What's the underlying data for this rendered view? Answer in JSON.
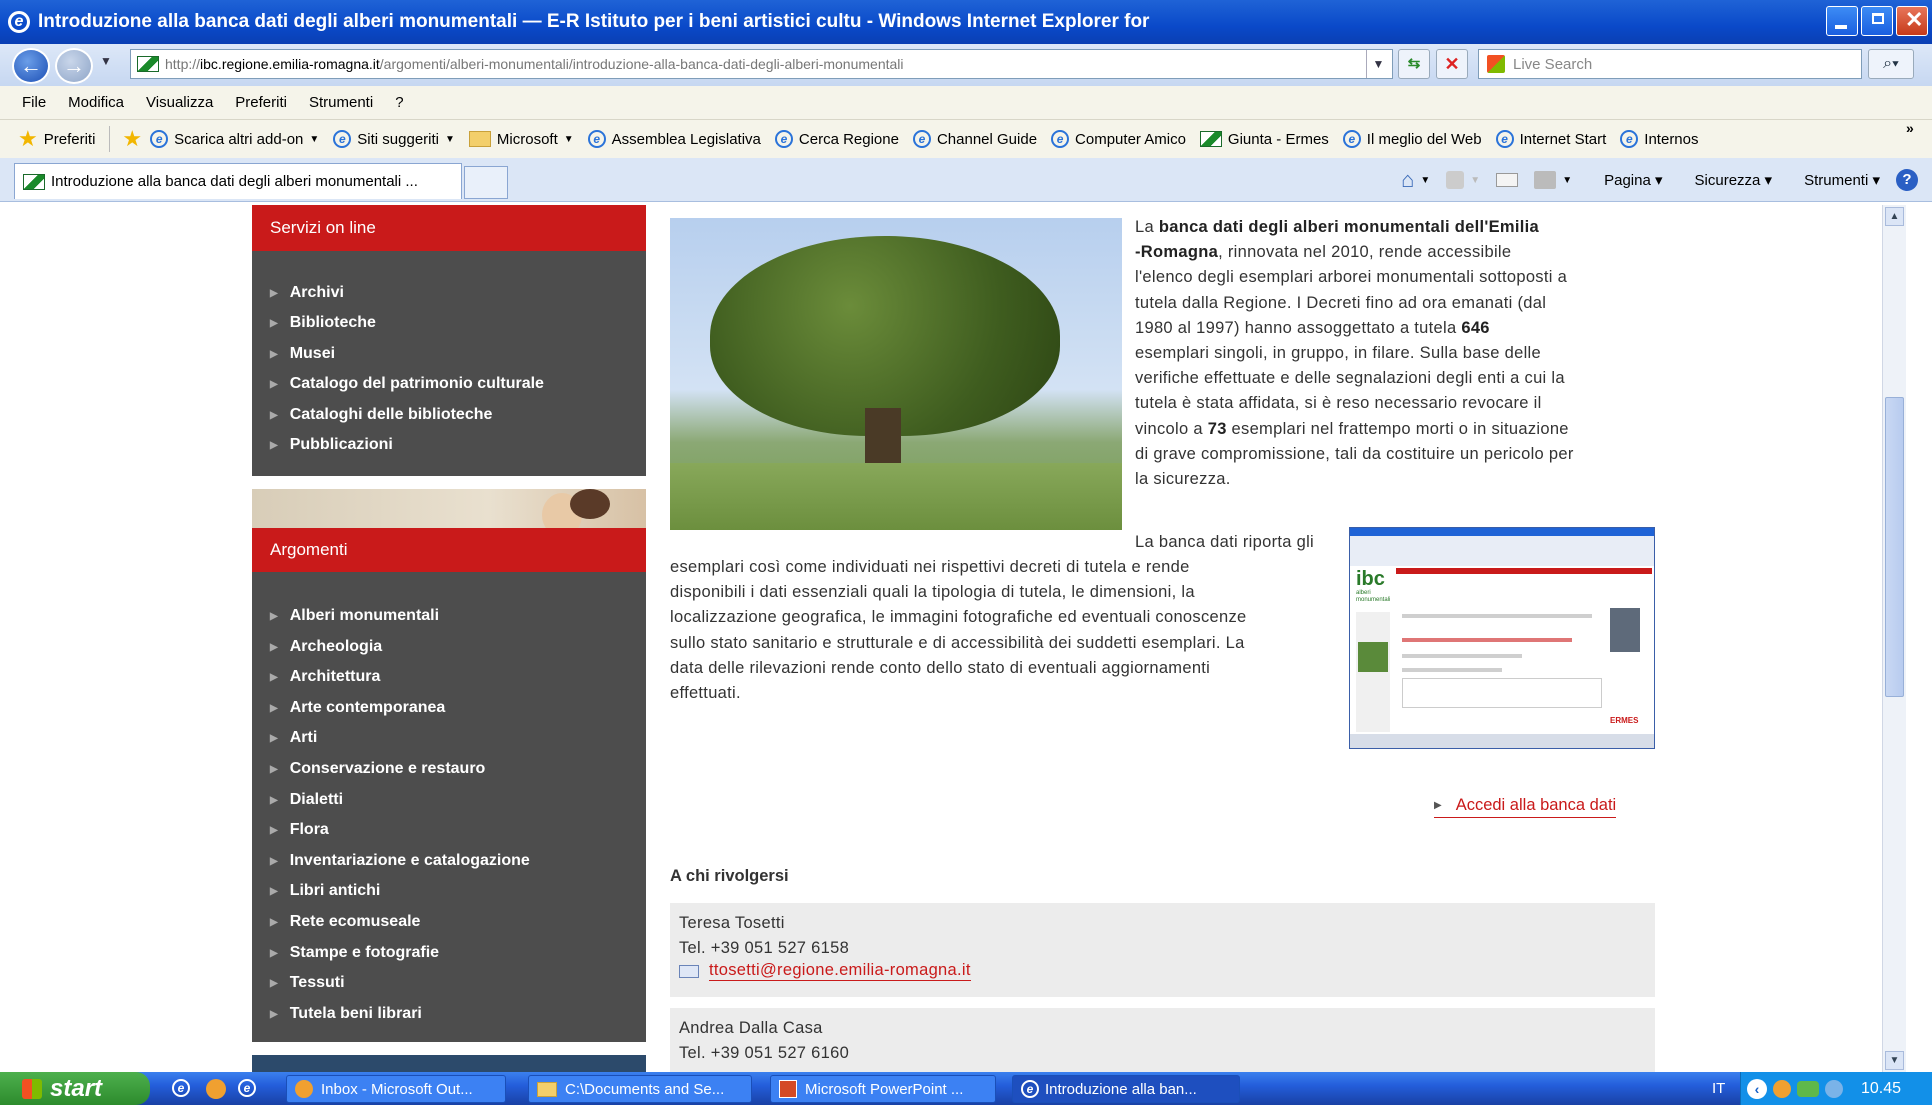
{
  "window": {
    "title": "Introduzione alla banca dati degli alberi monumentali — E-R Istituto per i beni artistici cultu - Windows Internet Explorer for"
  },
  "address": {
    "scheme": "http://",
    "host": "ibc.regione.emilia-romagna.it",
    "path": "/argomenti/alberi-monumentali/introduzione-alla-banca-dati-degli-alberi-monumentali"
  },
  "search": {
    "placeholder": "Live Search"
  },
  "menu": [
    "File",
    "Modifica",
    "Visualizza",
    "Preferiti",
    "Strumenti",
    "?"
  ],
  "favorites": {
    "label": "Preferiti",
    "items": [
      "Scarica altri add-on",
      "Siti suggeriti",
      "Microsoft",
      "Assemblea Legislativa",
      "Cerca Regione",
      "Channel Guide",
      "Computer Amico",
      "Giunta - Ermes",
      "Il meglio del Web",
      "Internet Start",
      "Internos"
    ]
  },
  "tab": {
    "label": "Introduzione alla banca dati degli alberi monumentali ..."
  },
  "command_bar": {
    "pagina": "Pagina",
    "sicurezza": "Sicurezza",
    "strumenti": "Strumenti"
  },
  "sidebar": {
    "servizi_title": "Servizi on line",
    "servizi": [
      "Archivi",
      "Biblioteche",
      "Musei",
      "Catalogo del patrimonio culturale",
      "Cataloghi delle biblioteche",
      "Pubblicazioni"
    ],
    "argomenti_title": "Argomenti",
    "argomenti": [
      "Alberi monumentali",
      "Archeologia",
      "Architettura",
      "Arte contemporanea",
      "Arti",
      "Conservazione e restauro",
      "Dialetti",
      "Flora",
      "Inventariazione e catalogazione",
      "Libri antichi",
      "Rete ecomuseale",
      "Stampe e fotografie",
      "Tessuti",
      "Tutela beni librari"
    ]
  },
  "article": {
    "p1_lines": [
      [
        "La ",
        "banca dati degli alberi monumentali dell'Emilia"
      ],
      [
        "",
        "-Romagna",
        ", rinnovata nel 2010, rende accessibile"
      ],
      [
        "l'elenco degli esemplari arborei monumentali sottoposti a"
      ],
      [
        "tutela dalla Regione. I Decreti fino ad ora emanati (dal"
      ],
      [
        "1980 al 1997) hanno assoggettato a tutela ",
        "646"
      ],
      [
        "esemplari singoli, in gruppo, in filare. Sulla base delle"
      ],
      [
        "verifiche effettuate e delle segnalazioni degli enti a cui la"
      ],
      [
        "tutela è stata affidata, si è reso necessario revocare il"
      ],
      [
        "vincolo a ",
        "73",
        " esemplari nel frattempo morti o in situazione"
      ],
      [
        "di grave compromissione, tali da costituire un pericolo per"
      ],
      [
        "la sicurezza."
      ]
    ],
    "p2_lines": [
      "La banca dati riporta gli",
      "esemplari così come individuati nei rispettivi decreti di tutela e rende",
      "disponibili i dati essenziali quali la tipologia di tutela, le dimensioni, la",
      "localizzazione geografica, le immagini fotografiche ed eventuali conoscenze",
      "sullo stato sanitario e strutturale e di accessibilità dei suddetti esemplari. La",
      "data delle rilevazioni rende conto dello stato di eventuali aggiornamenti",
      "effettuati."
    ],
    "screenshot_logo": "ibc",
    "screenshot_logo_sub": "alberi monumentali",
    "screenshot_brand": "ERMES",
    "access_link": "Accedi alla banca dati",
    "contacts_title": "A chi rivolgersi",
    "contacts": [
      {
        "name": "Teresa Tosetti",
        "tel": "Tel. +39 051 527 6158",
        "email": "ttosetti@regione.emilia-romagna.it"
      },
      {
        "name": "Andrea Dalla Casa",
        "tel": "Tel. +39 051 527 6160"
      }
    ]
  },
  "taskbar": {
    "start": "start",
    "items": [
      "Inbox - Microsoft Out...",
      "C:\\Documents and Se...",
      "Microsoft PowerPoint ...",
      "Introduzione alla ban..."
    ],
    "lang": "IT",
    "clock": "10.45"
  },
  "colors": {
    "accent_red": "#c91a1a",
    "sidebar_gray": "#4d4d4d",
    "xp_blue": "#245edb"
  }
}
